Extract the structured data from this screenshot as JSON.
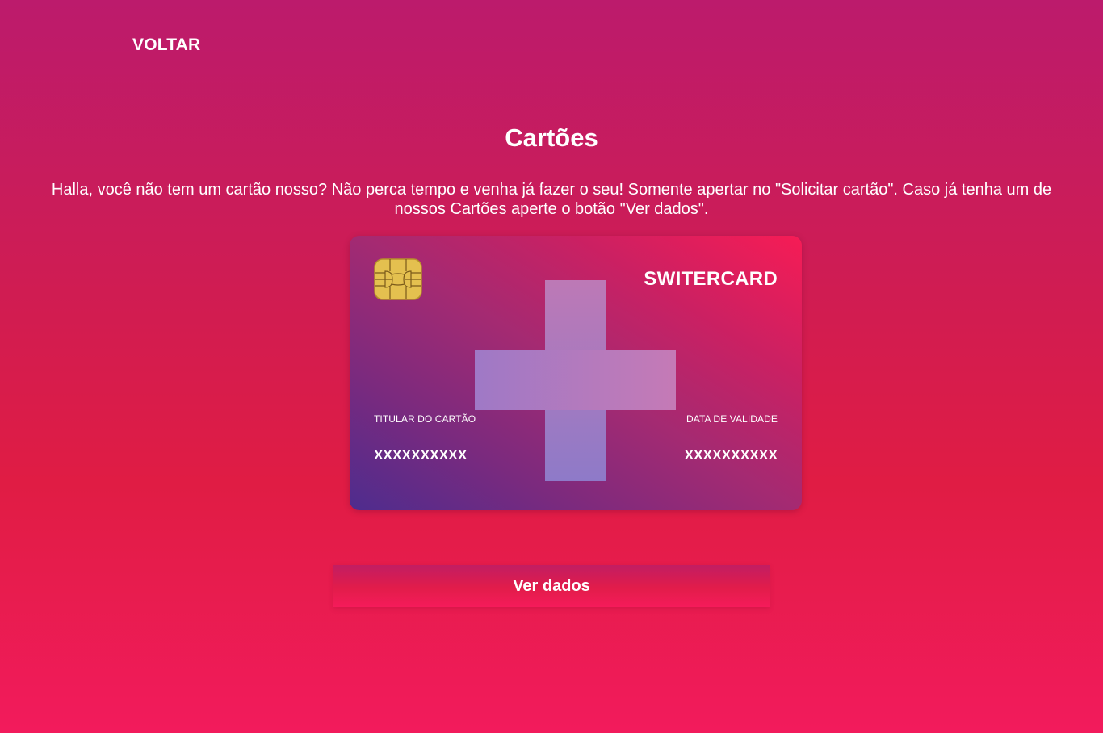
{
  "nav": {
    "back_label": "VOLTAR"
  },
  "page": {
    "title": "Cartões",
    "intro": "Halla, você não tem um cartão nosso? Não perca tempo e venha já fazer o seu! Somente apertar no \"Solicitar cartão\". Caso já tenha um de nossos Cartões aperte o botão \"Ver dados\"."
  },
  "card": {
    "brand": "SWITERCARD",
    "holder_label": "TITULAR DO CARTÃO",
    "holder_value": "XXXXXXXXXX",
    "expiry_label": "DATA DE VALIDADE",
    "expiry_value": "XXXXXXXXXX",
    "chip_icon": "card-chip-icon",
    "emblem_icon": "swiss-cross-icon"
  },
  "actions": {
    "view_data_label": "Ver dados"
  },
  "colors": {
    "background_top": "#bc1b6c",
    "background_bottom": "#f21b5c",
    "chip_gold": "#e4c04f",
    "cross_purple": "#a17ac4",
    "text": "#ffffff"
  }
}
